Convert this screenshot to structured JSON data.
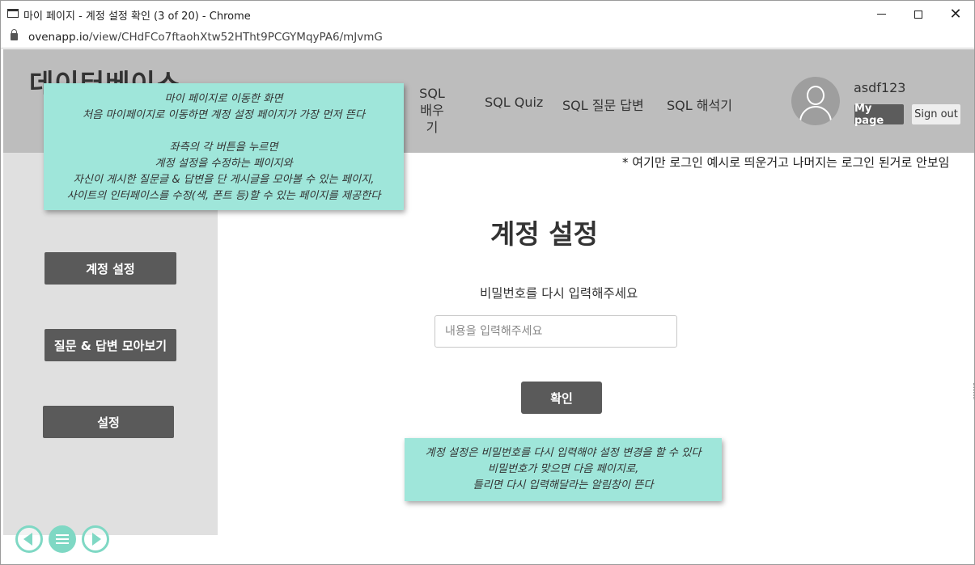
{
  "window": {
    "title": "마이 페이지 - 계정 설정 확인 (3 of 20) - Chrome",
    "minimize_icon": "minimize-icon",
    "maximize_icon": "maximize-icon",
    "close_glyph": "✕"
  },
  "address": {
    "host": "ovenapp.io",
    "path": "/view/CHdFCo7ftaohXtw52HTht9PCGYMqyPA6/mJvmG"
  },
  "header": {
    "logo": "데이터베이스",
    "nav": {
      "learn_line1": "SQL",
      "learn_line2": "배우기",
      "quiz": "SQL Quiz",
      "qa": "SQL 질문 답변",
      "interpreter": "SQL 해석기"
    },
    "user": {
      "username": "asdf123",
      "mypage_label": "My page",
      "signout_label": "Sign out"
    }
  },
  "login_note": "* 여기만 로그인 예시로 띄운거고 나머지는 로그인 된거로 안보임",
  "sidebar": {
    "account_settings": "계정 설정",
    "collect_qa": "질문 & 답변 모아보기",
    "settings": "설정"
  },
  "main": {
    "title": "계정 설정",
    "prompt": "비밀번호를 다시 입력해주세요",
    "input_placeholder": "내용을 입력해주세요",
    "confirm_label": "확인"
  },
  "sticky_top": {
    "line1": "마이 페이지로 이동한 화면",
    "line2": "처음 마이페이지로 이동하면 계정 설정 페이지가 가장 먼저 뜬다",
    "line3": "좌측의 각 버튼을 누르면",
    "line4": "계정 설정을 수정하는 페이지와",
    "line5": "자신이 게시한 질문글 & 답변을 단 게시글을 모아볼 수 있는 페이지,",
    "line6": "사이트의 인터페이스를 수정(색, 폰트 등)할 수 있는 페이지를 제공한다"
  },
  "sticky_bottom": {
    "line1": "계정 설정은 비밀번호를 다시 입력해야 설정 변경을 할 수 있다",
    "line2": "비밀번호가 맞으면 다음 페이지로,",
    "line3": "틀리면 다시 입력해달라는 알림창이 뜬다"
  },
  "colors": {
    "header_bg": "#bdbdbd",
    "sidebar_bg": "#e0e0e0",
    "button_dark": "#5a5a5a",
    "sticky_bg": "#9fe6da",
    "nav_circle": "#7fd8c4"
  }
}
